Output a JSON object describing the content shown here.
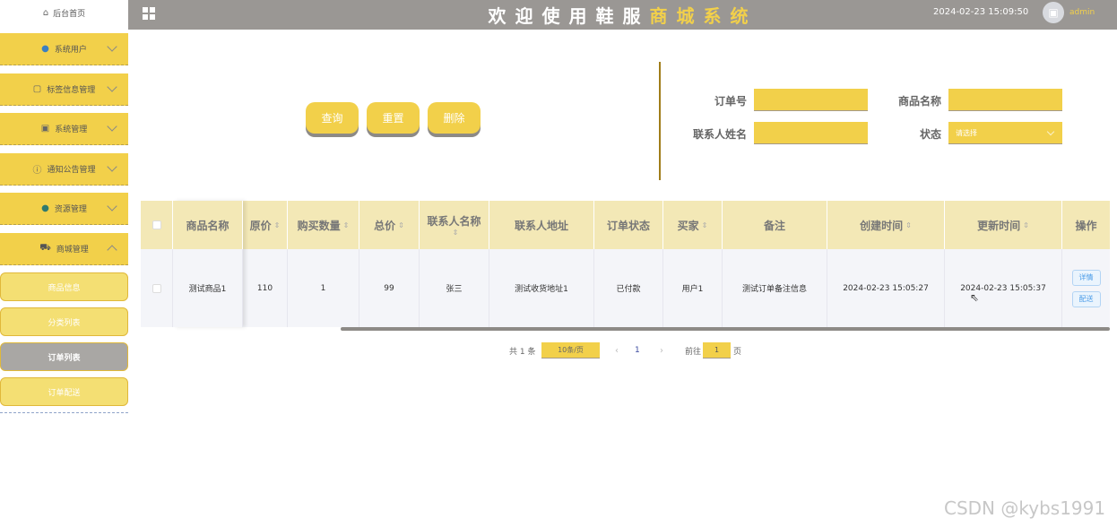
{
  "sidebar": {
    "home": "后台首页",
    "items": [
      {
        "label": "系统用户",
        "icon": "user-icon"
      },
      {
        "label": "标签信息管理",
        "icon": "edit-icon"
      },
      {
        "label": "系统管理",
        "icon": "image-icon"
      },
      {
        "label": "通知公告管理",
        "icon": "info-icon"
      },
      {
        "label": "资源管理",
        "icon": "location-icon"
      },
      {
        "label": "商城管理",
        "icon": "cart-icon"
      }
    ],
    "sub_items": [
      {
        "label": "商品信息",
        "active": false
      },
      {
        "label": "分类列表",
        "active": false
      },
      {
        "label": "订单列表",
        "active": true
      },
      {
        "label": "订单配送",
        "active": false
      }
    ]
  },
  "header": {
    "title_a": "欢迎使用鞋服",
    "title_b": "商城系统",
    "datetime": "2024-02-23 15:09:50",
    "username": "admin"
  },
  "actions": {
    "query": "查询",
    "reset": "重置",
    "delete": "删除"
  },
  "filters": {
    "order_no_label": "订单号",
    "product_name_label": "商品名称",
    "contact_name_label": "联系人姓名",
    "status_label": "状态",
    "status_placeholder": "请选择"
  },
  "table": {
    "headers": [
      "商品名称",
      "原价",
      "购买数量",
      "总价",
      "联系人名称",
      "联系人地址",
      "订单状态",
      "买家",
      "备注",
      "创建时间",
      "更新时间",
      "操作"
    ],
    "rows": [
      {
        "product": "测试商品1",
        "price": "110",
        "qty": "1",
        "total": "99",
        "contact": "张三",
        "address": "测试收货地址1",
        "status": "已付款",
        "buyer": "用户1",
        "remark": "测试订单备注信息",
        "created": "2024-02-23 15:05:27",
        "updated": "2024-02-23 15:05:37",
        "op_detail": "详情",
        "op_deliver": "配送"
      }
    ]
  },
  "pagination": {
    "total": "共 1 条",
    "page_size": "10条/页",
    "page": "1",
    "goto": "前往",
    "goto_value": "1",
    "page_suffix": "页"
  },
  "watermark": "CSDN @kybs1991",
  "colors": {
    "accent": "#f2d04a",
    "header_bg": "#9a9794",
    "active_sub": "#a9a7a4"
  }
}
